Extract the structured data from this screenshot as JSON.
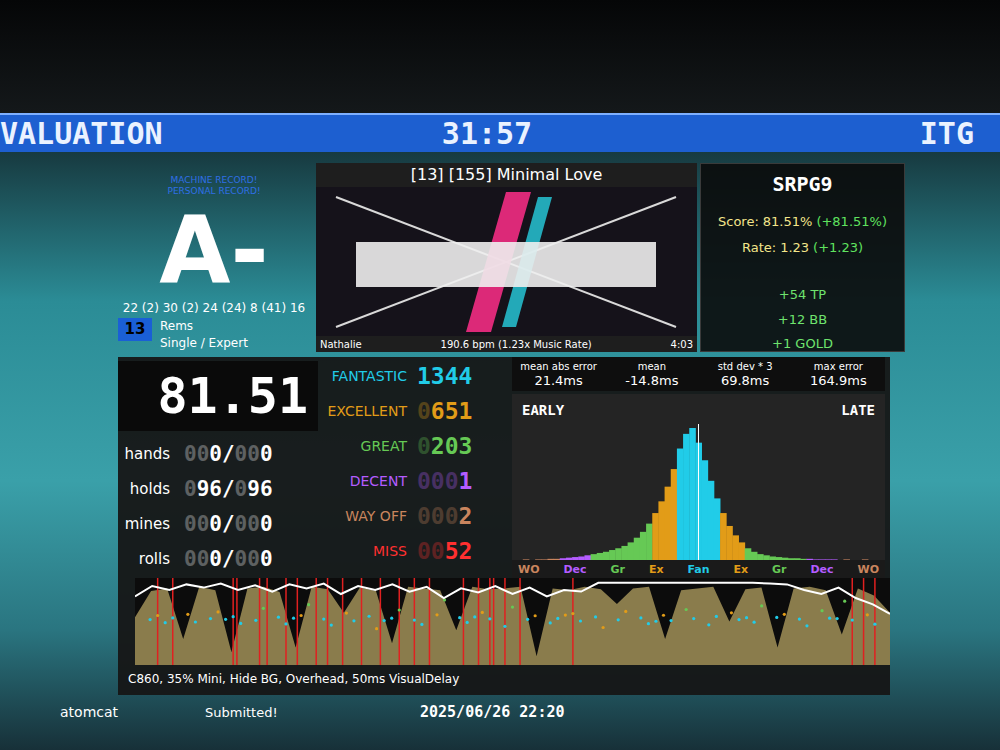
{
  "header": {
    "title": "VALUATION",
    "timer": "31:57",
    "mode": "ITG"
  },
  "records": [
    "MACHINE RECORD!",
    "PERSONAL RECORD!"
  ],
  "grade": "A-",
  "score_breakdown": "22 (2) 30 (2) 24 (24) 8 (41) 16",
  "stepchart": {
    "meter": "13",
    "name": "Rems",
    "style": "Single / Expert"
  },
  "song": {
    "title": "[13] [155] Minimal Love",
    "artist": "Nathalie",
    "bpm": "190.6 bpm (1.23x Music Rate)",
    "length": "4:03"
  },
  "event": {
    "name": "SRPG9",
    "lines": [
      {
        "label": "Score:",
        "value": "81.51%",
        "delta": "(+81.51%)"
      },
      {
        "label": "Rate:",
        "value": "1.23",
        "delta": "(+1.23)"
      }
    ],
    "rewards": [
      "+54 TP",
      "+12 BB",
      "+1 GOLD"
    ]
  },
  "score": "81.51",
  "counters": [
    {
      "label": "hands",
      "value": "000/000"
    },
    {
      "label": "holds",
      "value": "096/096"
    },
    {
      "label": "mines",
      "value": "000/000"
    },
    {
      "label": "rolls",
      "value": "000/000"
    }
  ],
  "judgments": [
    {
      "label": "FANTASTIC",
      "count": "1344",
      "color": "#21cce8"
    },
    {
      "label": "EXCELLENT",
      "count": "0651",
      "color": "#e29c18"
    },
    {
      "label": "GREAT",
      "count": "0203",
      "color": "#66c955"
    },
    {
      "label": "DECENT",
      "count": "0001",
      "color": "#b45cff"
    },
    {
      "label": "WAY OFF",
      "count": "0002",
      "color": "#c9855e"
    },
    {
      "label": "MISS",
      "count": "0052",
      "color": "#ff3030"
    }
  ],
  "stats": [
    {
      "label": "mean abs error",
      "value": "21.4ms"
    },
    {
      "label": "mean",
      "value": "-14.8ms"
    },
    {
      "label": "std dev * 3",
      "value": "69.8ms"
    },
    {
      "label": "max error",
      "value": "164.9ms"
    }
  ],
  "histogram": {
    "early_label": "EARLY",
    "late_label": "LATE",
    "range_ms": 181.5,
    "min_ms": -180,
    "bin_width_ms": 6,
    "counts": [
      0,
      0,
      1,
      0,
      1,
      1,
      2,
      2,
      3,
      4,
      5,
      6,
      8,
      10,
      12,
      14,
      17,
      20,
      24,
      30,
      38,
      48,
      62,
      80,
      100,
      125,
      155,
      190,
      215,
      225,
      200,
      170,
      135,
      105,
      80,
      58,
      42,
      30,
      20,
      14,
      10,
      8,
      6,
      5,
      4,
      3,
      3,
      2,
      2,
      1,
      1,
      1,
      1,
      0,
      1,
      0,
      0,
      1,
      0,
      0,
      0
    ],
    "windows": [
      {
        "name": "Fan",
        "ms": 23,
        "color": "#21cce8"
      },
      {
        "name": "Ex",
        "ms": 44.5,
        "color": "#e29c18"
      },
      {
        "name": "Gr",
        "ms": 103.5,
        "color": "#66c955"
      },
      {
        "name": "Dec",
        "ms": 136.5,
        "color": "#b45cff"
      },
      {
        "name": "WO",
        "ms": 181.5,
        "color": "#c9855e"
      }
    ],
    "axis_labels": [
      "WO",
      "Dec",
      "Gr",
      "Ex",
      "Fan",
      "Ex",
      "Gr",
      "Dec",
      "WO"
    ]
  },
  "timing_graph": {
    "density": [
      0.55,
      0.85,
      0.88,
      0.3,
      0.9,
      0.86,
      0.15,
      0.88,
      0.9,
      0.84,
      0.2,
      0.9,
      0.87,
      0.6,
      0.89,
      0.85,
      0.25,
      0.9,
      0.88,
      0.86,
      0.4,
      0.9,
      0.87,
      0.88,
      0.9,
      0.1,
      0.88,
      0.86,
      0.9,
      0.87,
      0.7,
      0.88,
      0.9,
      0.3,
      0.86,
      0.88,
      0.9,
      0.5,
      0.87,
      0.89,
      0.2,
      0.88,
      0.9,
      0.86,
      0.35,
      0.88,
      0.8,
      0.6
    ],
    "life": [
      0.82,
      0.95,
      0.9,
      0.97,
      0.93,
      0.98,
      0.9,
      0.96,
      0.88,
      0.97,
      0.92,
      0.98,
      0.85,
      0.95,
      0.9,
      0.97,
      0.88,
      0.94,
      0.8,
      0.92,
      0.87,
      0.95,
      0.85,
      0.93,
      0.82,
      0.9,
      0.88,
      0.99,
      0.99,
      0.99,
      0.99,
      0.99,
      0.99,
      0.99,
      0.99,
      0.99,
      0.99,
      0.98,
      0.97,
      0.9,
      0.85,
      0.93,
      0.8,
      0.72,
      0.6
    ],
    "misses": [
      0.03,
      0.05,
      0.13,
      0.135,
      0.165,
      0.175,
      0.2,
      0.215,
      0.24,
      0.255,
      0.275,
      0.3,
      0.325,
      0.35,
      0.37,
      0.39,
      0.435,
      0.455,
      0.47,
      0.475,
      0.49,
      0.51,
      0.58,
      0.95,
      0.965,
      0.98
    ],
    "points": [
      [
        0.02,
        -8
      ],
      [
        0.04,
        5
      ],
      [
        0.05,
        -15
      ],
      [
        0.07,
        -30
      ],
      [
        0.08,
        2
      ],
      [
        0.1,
        -12
      ],
      [
        0.11,
        -40
      ],
      [
        0.13,
        -20
      ],
      [
        0.14,
        8
      ],
      [
        0.16,
        -5
      ],
      [
        0.17,
        -55
      ],
      [
        0.19,
        -18
      ],
      [
        0.2,
        10
      ],
      [
        0.22,
        -25
      ],
      [
        0.23,
        -70
      ],
      [
        0.25,
        -10
      ],
      [
        0.26,
        15
      ],
      [
        0.28,
        -35
      ],
      [
        0.29,
        -3
      ],
      [
        0.31,
        -22
      ],
      [
        0.32,
        30
      ],
      [
        0.34,
        -14
      ],
      [
        0.35,
        -48
      ],
      [
        0.37,
        -6
      ],
      [
        0.38,
        12
      ],
      [
        0.4,
        -28
      ],
      [
        0.41,
        -90
      ],
      [
        0.43,
        -16
      ],
      [
        0.44,
        4
      ],
      [
        0.46,
        -38
      ],
      [
        0.47,
        -11
      ],
      [
        0.49,
        20
      ],
      [
        0.5,
        -60
      ],
      [
        0.52,
        -9
      ],
      [
        0.53,
        -24
      ],
      [
        0.55,
        6
      ],
      [
        0.56,
        -13
      ],
      [
        0.58,
        -33
      ],
      [
        0.59,
        -2
      ],
      [
        0.61,
        -19
      ],
      [
        0.62,
        25
      ],
      [
        0.64,
        -7
      ],
      [
        0.65,
        -42
      ],
      [
        0.67,
        -15
      ],
      [
        0.68,
        9
      ],
      [
        0.7,
        -26
      ],
      [
        0.71,
        -4
      ],
      [
        0.73,
        -50
      ],
      [
        0.74,
        -12
      ],
      [
        0.76,
        14
      ],
      [
        0.77,
        -21
      ],
      [
        0.79,
        -36
      ],
      [
        0.8,
        -8
      ],
      [
        0.82,
        3
      ],
      [
        0.83,
        -65
      ],
      [
        0.85,
        -17
      ],
      [
        0.86,
        -30
      ],
      [
        0.88,
        -10
      ],
      [
        0.89,
        18
      ],
      [
        0.91,
        -45
      ],
      [
        0.92,
        -14
      ],
      [
        0.94,
        -85
      ],
      [
        0.95,
        -6
      ],
      [
        0.97,
        -28
      ],
      [
        0.98,
        11
      ],
      [
        0.03,
        -25
      ],
      [
        0.12,
        -9
      ],
      [
        0.21,
        -14
      ],
      [
        0.33,
        -4
      ],
      [
        0.45,
        -19
      ],
      [
        0.57,
        -27
      ],
      [
        0.69,
        -1
      ],
      [
        0.81,
        -16
      ],
      [
        0.93,
        -12
      ]
    ]
  },
  "modifiers": "C860, 35% Mini, Hide BG, Overhead, 50ms VisualDelay",
  "footer": {
    "player": "atomcat",
    "status": "Submitted!",
    "date": "2025/06/26 22:20"
  }
}
